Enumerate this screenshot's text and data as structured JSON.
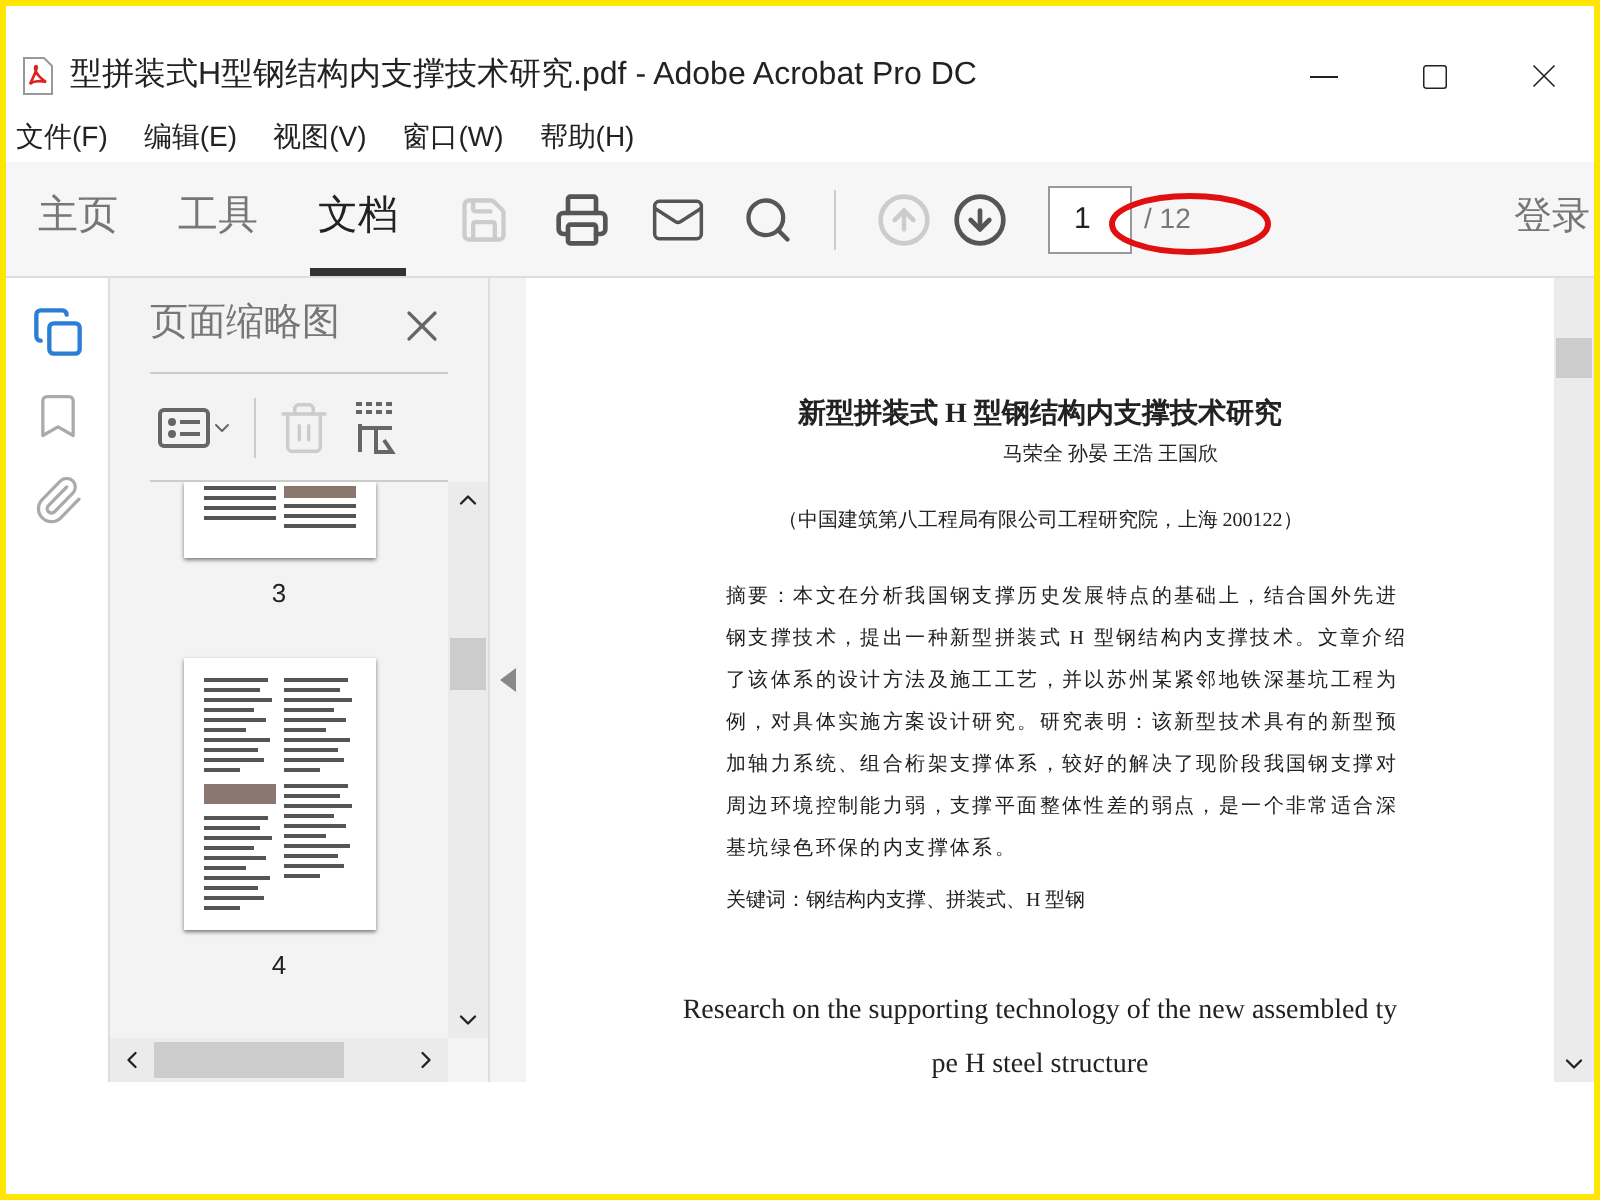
{
  "window": {
    "title": "型拼装式H型钢结构内支撑技术研究.pdf - Adobe Acrobat Pro DC"
  },
  "menu": [
    "文件(F)",
    "编辑(E)",
    "视图(V)",
    "窗口(W)",
    "帮助(H)"
  ],
  "tabs": [
    {
      "label": "主页",
      "selected": false
    },
    {
      "label": "工具",
      "selected": false
    },
    {
      "label": "文档",
      "selected": true
    }
  ],
  "toolbar": {
    "save_disabled": true,
    "prev_disabled": true,
    "page": "1",
    "page_total": "/ 12",
    "sign_in": "登录"
  },
  "sidebar": {
    "title": "页面缩略图",
    "thumbnails": [
      {
        "label": "3"
      },
      {
        "label": "4"
      }
    ]
  },
  "document": {
    "title": "新型拼装式 H 型钢结构内支撑技术研究",
    "authors": "马荣全  孙晏  王浩  王国欣",
    "affiliation": "（中国建筑第八工程局有限公司工程研究院，上海 200122）",
    "abstract": [
      "摘要：本文在分析我国钢支撑历史发展特点的基础上，结合国外先进",
      "钢支撑技术，提出一种新型拼装式 H 型钢结构内支撑技术。文章介绍",
      "了该体系的设计方法及施工工艺，并以苏州某紧邻地铁深基坑工程为",
      "例，对具体实施方案设计研究。研究表明：该新型技术具有的新型预",
      "加轴力系统、组合桁架支撑体系，较好的解决了现阶段我国钢支撑对",
      "周边环境控制能力弱，支撑平面整体性差的弱点，是一个非常适合深",
      "基坑绿色环保的内支撑体系。"
    ],
    "keywords": "关键词：钢结构内支撑、拼装式、H 型钢",
    "english_title": [
      "Research on the supporting technology of the new assembled ty",
      "pe H steel structure"
    ]
  }
}
